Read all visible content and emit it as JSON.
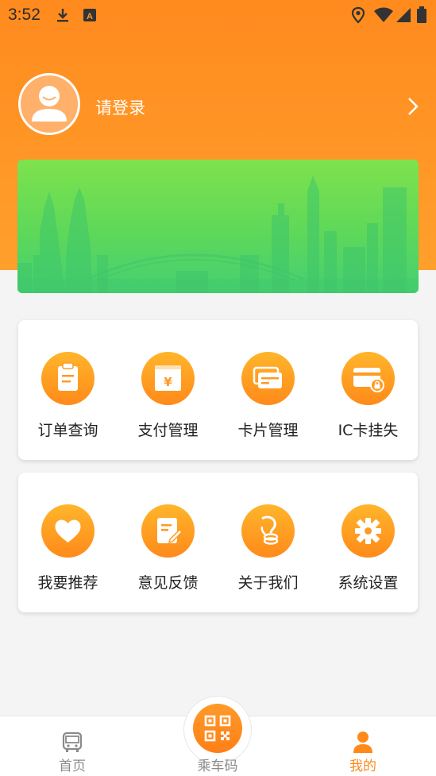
{
  "status_bar": {
    "time": "3:52",
    "icons": [
      "download-icon",
      "a-icon",
      "location-icon",
      "wifi-icon",
      "signal-icon",
      "battery-icon"
    ]
  },
  "profile": {
    "login_prompt": "请登录"
  },
  "menu_group_1": [
    {
      "label": "订单查询",
      "icon": "order-clipboard-icon"
    },
    {
      "label": "支付管理",
      "icon": "yuan-wallet-icon"
    },
    {
      "label": "卡片管理",
      "icon": "cards-icon"
    },
    {
      "label": "IC卡挂失",
      "icon": "card-lock-icon"
    }
  ],
  "menu_group_2": [
    {
      "label": "我要推荐",
      "icon": "heart-icon"
    },
    {
      "label": "意见反馈",
      "icon": "feedback-edit-icon"
    },
    {
      "label": "关于我们",
      "icon": "about-icon"
    },
    {
      "label": "系统设置",
      "icon": "gear-icon"
    }
  ],
  "bottom_nav": {
    "home": "首页",
    "qr": "乘车码",
    "mine": "我的",
    "active": "mine"
  },
  "colors": {
    "accent": "#ff8a1a",
    "header_top": "#ff8a1e",
    "banner_green": "#5ed85a"
  }
}
